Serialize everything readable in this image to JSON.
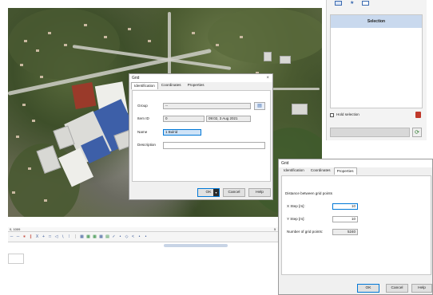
{
  "status": {
    "left": "0, 1009",
    "right": "5"
  },
  "grid_main": {
    "title": "Grid",
    "tabs": [
      "Identification",
      "Coordinates",
      "Properties"
    ],
    "group_label": "Group",
    "group_value": "--",
    "item_id_label": "Item ID",
    "item_id_value": "0",
    "date_value": "09:02, 3 Aug 2021",
    "name_label": "Name",
    "name_value": "1 Bulrid",
    "description_label": "Description",
    "ok": "OK",
    "cancel": "Cancel",
    "help": "Help"
  },
  "grid_props": {
    "title": "Grid",
    "tabs": [
      "Identification",
      "Coordinates",
      "Properties"
    ],
    "section": "Distance between grid points",
    "x_label": "X Step [m]:",
    "x_value": "10",
    "y_label": "Y Step [m]:",
    "y_value": "10",
    "count_label": "Number of grid points:",
    "count_value": "5240",
    "ok": "OK",
    "cancel": "Cancel",
    "help": "Help"
  },
  "side_panel": {
    "header": "Selection",
    "hold_label": "Hold selection"
  },
  "colors": {
    "accent": "#0078d7",
    "header_blue": "#c9d9ee"
  }
}
